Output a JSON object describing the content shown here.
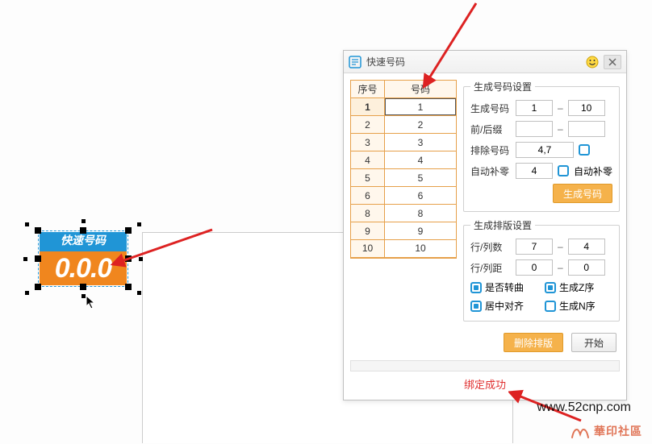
{
  "canvas_object": {
    "caption": "快速号码",
    "value": "0.0.0"
  },
  "dialog": {
    "title": "快速号码"
  },
  "table": {
    "col_seq": "序号",
    "col_num": "号码",
    "rows": [
      {
        "seq": "1",
        "val": "1"
      },
      {
        "seq": "2",
        "val": "2"
      },
      {
        "seq": "3",
        "val": "3"
      },
      {
        "seq": "4",
        "val": "4"
      },
      {
        "seq": "5",
        "val": "5"
      },
      {
        "seq": "6",
        "val": "6"
      },
      {
        "seq": "8",
        "val": "8"
      },
      {
        "seq": "9",
        "val": "9"
      },
      {
        "seq": "10",
        "val": "10"
      }
    ],
    "selected_index": 0
  },
  "gen_settings": {
    "legend": "生成号码设置",
    "range_label": "生成号码",
    "range_from": "1",
    "range_to": "10",
    "prefix_label": "前/后缀",
    "prefix": "",
    "suffix": "",
    "exclude_label": "排除号码",
    "exclude": "4,7",
    "autozero_label": "自动补零",
    "autozero_width": "4",
    "autozero_chk_label": "自动补零",
    "generate_btn": "生成号码"
  },
  "layout_settings": {
    "legend": "生成排版设置",
    "grid_label": "行/列数",
    "rows": "7",
    "cols": "4",
    "spacing_label": "行/列距",
    "rowgap": "0",
    "colgap": "0",
    "rotate_label": "是否转曲",
    "z_label": "生成Z序",
    "center_label": "居中对齐",
    "n_label": "生成N序"
  },
  "footer": {
    "delete_btn": "删除排版",
    "start_btn": "开始"
  },
  "status": "绑定成功",
  "watermark": {
    "brand": "華印社區",
    "url": "www.52cnp.com"
  }
}
